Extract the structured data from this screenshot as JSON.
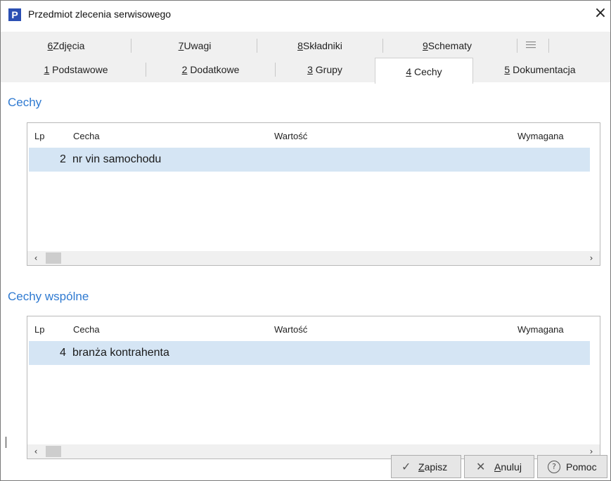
{
  "window": {
    "title": "Przedmiot zlecenia serwisowego",
    "app_icon_letter": "P",
    "close_glyph": "×"
  },
  "tabs_row1": [
    {
      "key": "6",
      "label": "Zdjęcia"
    },
    {
      "key": "7",
      "label": "Uwagi"
    },
    {
      "key": "8",
      "label": "Składniki"
    },
    {
      "key": "9",
      "label": "Schematy"
    }
  ],
  "tabs_row2": [
    {
      "key": "1",
      "label": "Podstawowe"
    },
    {
      "key": "2",
      "label": "Dodatkowe"
    },
    {
      "key": "3",
      "label": "Grupy"
    },
    {
      "key": "4",
      "label": "Cechy",
      "active": true
    },
    {
      "key": "5",
      "label": "Dokumentacja"
    }
  ],
  "cechy": {
    "title": "Cechy",
    "columns": [
      "Lp",
      "Cecha",
      "Wartość",
      "Wymagana"
    ],
    "rows": [
      {
        "lp": "2",
        "cecha": "nr vin samochodu",
        "wartosc": "",
        "wymagana": ""
      }
    ]
  },
  "cechy_wspolne": {
    "title": "Cechy wspólne",
    "columns": [
      "Lp",
      "Cecha",
      "Wartość",
      "Wymagana"
    ],
    "rows": [
      {
        "lp": "4",
        "cecha": "branża kontrahenta",
        "wartosc": "",
        "wymagana": ""
      }
    ]
  },
  "scroll": {
    "left_glyph": "‹",
    "right_glyph": "›"
  },
  "buttons": {
    "save": {
      "icon": "checkmark-icon",
      "glyph": "✓",
      "mnemonic": "Z",
      "rest": "apisz"
    },
    "cancel": {
      "icon": "x-icon",
      "glyph": "✕",
      "mnemonic": "A",
      "rest": "nuluj"
    },
    "help": {
      "icon": "help-circle-icon",
      "glyph": "?",
      "label": "Pomoc"
    }
  },
  "colors": {
    "section_title": "#2f7ad1",
    "selected_row": "#d5e5f4",
    "app_icon": "#2b4fb3"
  }
}
